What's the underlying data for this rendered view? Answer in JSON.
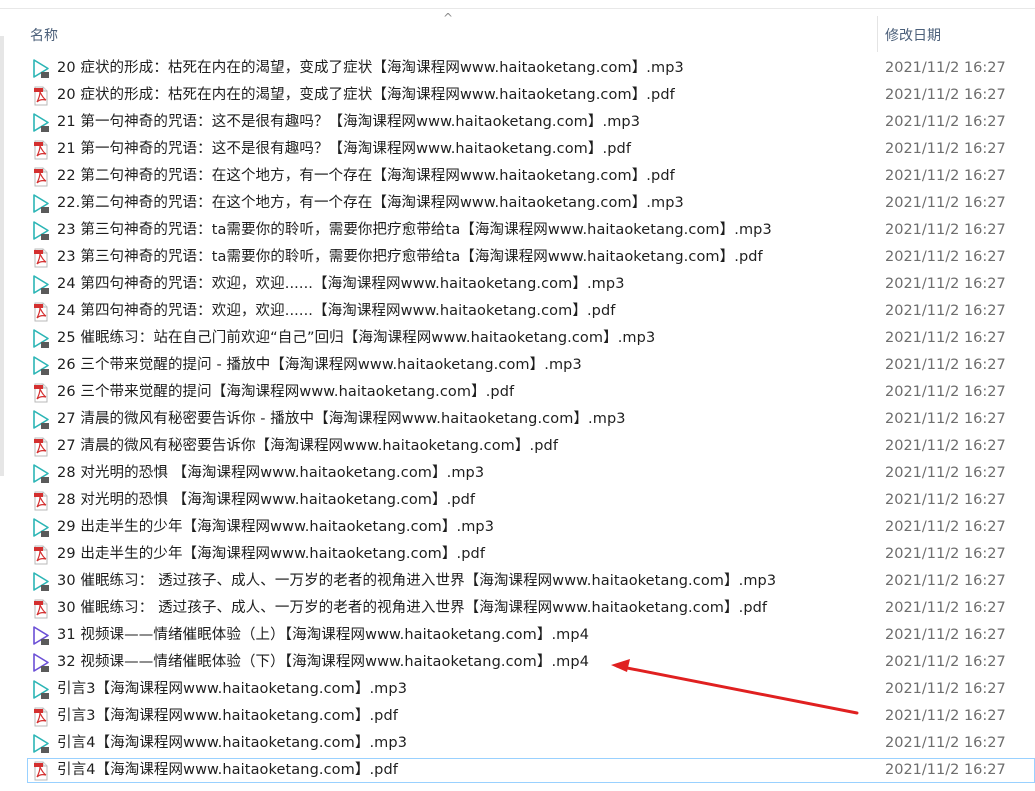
{
  "header": {
    "name_label": "名称",
    "date_label": "修改日期",
    "sort_indicator": "^"
  },
  "rows": [
    {
      "name": "20 症状的形成：枯死在内在的渴望，变成了症状【海淘课程网www.haitaoketang.com】.mp3",
      "date": "2021/11/2 16:27",
      "icon": "mp3-audio-icon"
    },
    {
      "name": "20 症状的形成：枯死在内在的渴望，变成了症状【海淘课程网www.haitaoketang.com】.pdf",
      "date": "2021/11/2 16:27",
      "icon": "pdf-file-icon"
    },
    {
      "name": "21 第一句神奇的咒语：这不是很有趣吗？【海淘课程网www.haitaoketang.com】.mp3",
      "date": "2021/11/2 16:27",
      "icon": "mp3-audio-icon"
    },
    {
      "name": "21 第一句神奇的咒语：这不是很有趣吗？【海淘课程网www.haitaoketang.com】.pdf",
      "date": "2021/11/2 16:27",
      "icon": "pdf-file-icon"
    },
    {
      "name": "22 第二句神奇的咒语：在这个地方，有一个存在【海淘课程网www.haitaoketang.com】.pdf",
      "date": "2021/11/2 16:27",
      "icon": "pdf-file-icon"
    },
    {
      "name": "22.第二句神奇的咒语：在这个地方，有一个存在【海淘课程网www.haitaoketang.com】.mp3",
      "date": "2021/11/2 16:27",
      "icon": "mp3-audio-icon"
    },
    {
      "name": "23 第三句神奇的咒语：ta需要你的聆听，需要你把疗愈带给ta【海淘课程网www.haitaoketang.com】.mp3",
      "date": "2021/11/2 16:27",
      "icon": "mp3-audio-icon"
    },
    {
      "name": "23 第三句神奇的咒语：ta需要你的聆听，需要你把疗愈带给ta【海淘课程网www.haitaoketang.com】.pdf",
      "date": "2021/11/2 16:27",
      "icon": "pdf-file-icon"
    },
    {
      "name": "24 第四句神奇的咒语：欢迎，欢迎......【海淘课程网www.haitaoketang.com】.mp3",
      "date": "2021/11/2 16:27",
      "icon": "mp3-audio-icon"
    },
    {
      "name": "24 第四句神奇的咒语：欢迎，欢迎......【海淘课程网www.haitaoketang.com】.pdf",
      "date": "2021/11/2 16:27",
      "icon": "pdf-file-icon"
    },
    {
      "name": "25 催眠练习：站在自己门前欢迎“自己”回归【海淘课程网www.haitaoketang.com】.mp3",
      "date": "2021/11/2 16:27",
      "icon": "mp3-audio-icon"
    },
    {
      "name": "26 三个带来觉醒的提问 - 播放中【海淘课程网www.haitaoketang.com】.mp3",
      "date": "2021/11/2 16:27",
      "icon": "mp3-audio-icon"
    },
    {
      "name": "26 三个带来觉醒的提问【海淘课程网www.haitaoketang.com】.pdf",
      "date": "2021/11/2 16:27",
      "icon": "pdf-file-icon"
    },
    {
      "name": "27 清晨的微风有秘密要告诉你 - 播放中【海淘课程网www.haitaoketang.com】.mp3",
      "date": "2021/11/2 16:27",
      "icon": "mp3-audio-icon"
    },
    {
      "name": "27 清晨的微风有秘密要告诉你【海淘课程网www.haitaoketang.com】.pdf",
      "date": "2021/11/2 16:27",
      "icon": "pdf-file-icon"
    },
    {
      "name": "28 对光明的恐惧 【海淘课程网www.haitaoketang.com】.mp3",
      "date": "2021/11/2 16:27",
      "icon": "mp3-audio-icon"
    },
    {
      "name": "28 对光明的恐惧 【海淘课程网www.haitaoketang.com】.pdf",
      "date": "2021/11/2 16:27",
      "icon": "pdf-file-icon"
    },
    {
      "name": "29 出走半生的少年【海淘课程网www.haitaoketang.com】.mp3",
      "date": "2021/11/2 16:27",
      "icon": "mp3-audio-icon"
    },
    {
      "name": "29 出走半生的少年【海淘课程网www.haitaoketang.com】.pdf",
      "date": "2021/11/2 16:27",
      "icon": "pdf-file-icon"
    },
    {
      "name": "30 催眠练习： 透过孩子、成人、一万岁的老者的视角进入世界【海淘课程网www.haitaoketang.com】.mp3",
      "date": "2021/11/2 16:27",
      "icon": "mp3-audio-icon"
    },
    {
      "name": "30 催眠练习： 透过孩子、成人、一万岁的老者的视角进入世界【海淘课程网www.haitaoketang.com】.pdf",
      "date": "2021/11/2 16:27",
      "icon": "pdf-file-icon"
    },
    {
      "name": "31 视频课——情绪催眠体验（上）【海淘课程网www.haitaoketang.com】.mp4",
      "date": "2021/11/2 16:27",
      "icon": "mp4-video-icon"
    },
    {
      "name": "32 视频课——情绪催眠体验（下）【海淘课程网www.haitaoketang.com】.mp4",
      "date": "2021/11/2 16:27",
      "icon": "mp4-video-icon"
    },
    {
      "name": "引言3【海淘课程网www.haitaoketang.com】.mp3",
      "date": "2021/11/2 16:27",
      "icon": "mp3-audio-icon"
    },
    {
      "name": "引言3【海淘课程网www.haitaoketang.com】.pdf",
      "date": "2021/11/2 16:27",
      "icon": "pdf-file-icon"
    },
    {
      "name": "引言4【海淘课程网www.haitaoketang.com】.mp3",
      "date": "2021/11/2 16:27",
      "icon": "mp3-audio-icon"
    },
    {
      "name": "引言4【海淘课程网www.haitaoketang.com】.pdf",
      "date": "2021/11/2 16:27",
      "icon": "pdf-file-icon",
      "selected": true
    }
  ],
  "colors": {
    "mp3_icon": "#2bb5b5",
    "mp4_icon": "#6b4fd6",
    "pdf_icon": "#d42f2f",
    "annotation_arrow": "#e02020",
    "selection_border": "#99d1ff"
  }
}
